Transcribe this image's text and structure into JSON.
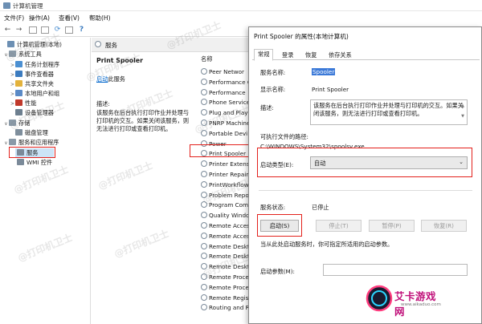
{
  "window": {
    "title": "计算机管理"
  },
  "menu": [
    "文件(F)",
    "操作(A)",
    "查看(V)",
    "帮助(H)"
  ],
  "tree": [
    {
      "label": "计算机管理(本地)",
      "depth": 0,
      "exp": "",
      "color": "#6c8fb3"
    },
    {
      "label": "系统工具",
      "depth": 1,
      "exp": "∨",
      "color": "#8a9aa8"
    },
    {
      "label": "任务计划程序",
      "depth": 2,
      "exp": ">",
      "color": "#4b8fd1"
    },
    {
      "label": "事件查看器",
      "depth": 2,
      "exp": ">",
      "color": "#3b7bbf"
    },
    {
      "label": "共享文件夹",
      "depth": 2,
      "exp": ">",
      "color": "#e3b23c"
    },
    {
      "label": "本地用户和组",
      "depth": 2,
      "exp": ">",
      "color": "#5a8ac6"
    },
    {
      "label": "性能",
      "depth": 2,
      "exp": ">",
      "color": "#c0392b"
    },
    {
      "label": "设备管理器",
      "depth": 2,
      "exp": "",
      "color": "#6d7f8f"
    },
    {
      "label": "存储",
      "depth": 1,
      "exp": "∨",
      "color": "#8a9aa8"
    },
    {
      "label": "磁盘管理",
      "depth": 2,
      "exp": "",
      "color": "#7e8e9c"
    },
    {
      "label": "服务和应用程序",
      "depth": 1,
      "exp": "∨",
      "color": "#8a9aa8"
    },
    {
      "label": "服务",
      "depth": 2,
      "exp": "",
      "color": "#7b8a99"
    },
    {
      "label": "WMI 控件",
      "depth": 2,
      "exp": "",
      "color": "#7b8a99"
    }
  ],
  "middle": {
    "header": "服务",
    "service_title": "Print Spooler",
    "start_link": "启动",
    "start_suffix": "此服务",
    "desc_label": "描述:",
    "desc_text": "该服务在后台执行打印作业并处理与打印机的交互。如果关闭该服务，则无法进行打印或查看打印机。",
    "col_name": "名称",
    "services": [
      "Peer Networ",
      "Performance C",
      "Performance",
      "Phone Service",
      "Plug and Play",
      "PNRP Machine",
      "Portable Devi",
      "Power",
      "Print Spooler",
      "Printer Extensi",
      "Printer Repair",
      "PrintWorkflow",
      "Problem Repor",
      "Program Comp",
      "Quality Windo",
      "Remote Access",
      "Remote Access",
      "Remote Deskt",
      "Remote Deskt",
      "Remote Deskt",
      "Remote Proce",
      "Remote Proce",
      "Remote Regis",
      "Routing and R"
    ]
  },
  "dialog": {
    "title": "Print Spooler 的属性(本地计算机)",
    "tabs": [
      "常规",
      "登录",
      "恢复",
      "依存关系"
    ],
    "service_name_label": "服务名称:",
    "service_name": "Spooler",
    "display_name_label": "显示名称:",
    "display_name": "Print Spooler",
    "desc_label": "描述:",
    "desc": "该服务在后台执行打印作业并处理与打印机的交互。如果关闭该服务，则无法进行打印或查看打印机。",
    "path_label": "可执行文件的路径:",
    "path": "C:\\WINDOWS\\System32\\spoolsv.exe",
    "startup_type_label": "启动类型(E):",
    "startup_type": "自动",
    "status_label": "服务状态:",
    "status": "已停止",
    "buttons": {
      "start": "启动(S)",
      "stop": "停止(T)",
      "pause": "暂停(P)",
      "resume": "恢复(R)"
    },
    "hint": "当从此处启动服务时，你可指定所适用的启动参数。",
    "params_label": "启动参数(M):"
  },
  "watermarks": [
    "@打印机卫士",
    "@打印机卫士",
    "@打印机卫士",
    "@打印机卫士",
    "@打印机卫士",
    "@打印机卫士",
    "@打印机卫士",
    "@打印机卫士",
    "@打印机卫士",
    "@打印机卫士",
    "@打印机卫士",
    "@打印机卫士"
  ],
  "logo": {
    "text": "艾卡游戏网",
    "url": "www.aikaduo.com"
  },
  "colors": {
    "highlight_red": "#e3201b",
    "selection": "#cce4f7",
    "link": "#0066cc"
  }
}
